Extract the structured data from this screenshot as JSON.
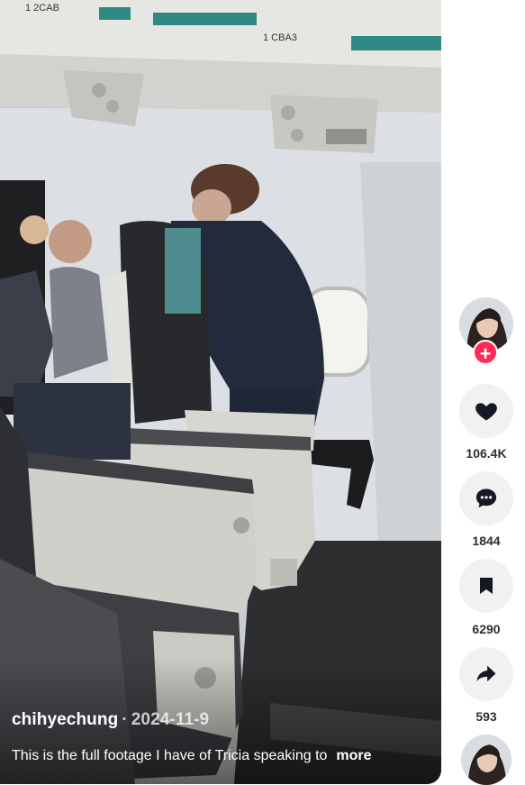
{
  "video": {
    "username": "chihyechung",
    "separator": "·",
    "date": "2024-11-9",
    "caption": "This is the full footage I have of Tricia speaking to",
    "more_label": "more",
    "overhead_labels": [
      "1 2CAB",
      "1 CBA3"
    ]
  },
  "rail": {
    "follow_label": "+",
    "actions": [
      {
        "name": "like",
        "icon": "heart-icon",
        "count": "106.4K"
      },
      {
        "name": "comment",
        "icon": "comment-icon",
        "count": "1844"
      },
      {
        "name": "save",
        "icon": "bookmark-icon",
        "count": "6290"
      },
      {
        "name": "share",
        "icon": "share-arrow-icon",
        "count": "593"
      }
    ]
  },
  "colors": {
    "follow_accent": "#fe2c55",
    "rail_button_bg": "#f1f1f2",
    "icon": "#161823"
  }
}
